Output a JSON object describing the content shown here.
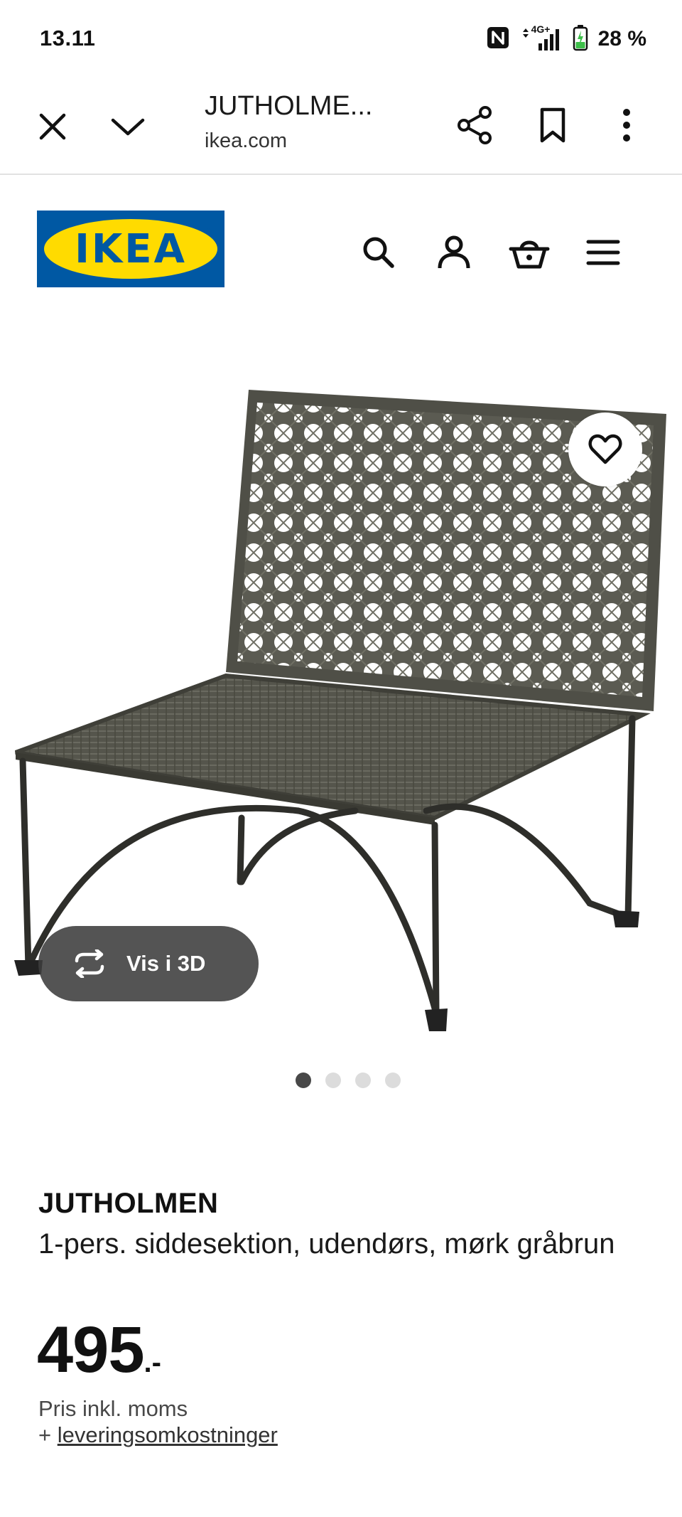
{
  "status_bar": {
    "time": "13.11",
    "network": "4G+",
    "battery": "28 %"
  },
  "browser": {
    "title": "JUTHOLME...",
    "domain": "ikea.com",
    "icons": [
      "close-icon",
      "chevron-down-icon",
      "share-icon",
      "bookmark-icon",
      "more-vertical-icon"
    ]
  },
  "ikea": {
    "logo_text": "IKEA",
    "icons": [
      "search-icon",
      "user-icon",
      "basket-icon",
      "menu-icon"
    ]
  },
  "gallery": {
    "view3d_label": "Vis i 3D",
    "dot_count": 4,
    "active_dot": 0
  },
  "product": {
    "name": "JUTHOLMEN",
    "description": "1-pers. siddesektion, udendørs, mørk gråbrun",
    "price_int": "495",
    "price_suffix": ".-",
    "price_note": "Pris inkl. moms",
    "delivery_prefix": "+ ",
    "delivery_link": "leveringsomkostninger"
  },
  "colors": {
    "ikea_blue": "#0058a3",
    "ikea_yellow": "#ffdb00",
    "battery_green": "#3dbf4a"
  }
}
